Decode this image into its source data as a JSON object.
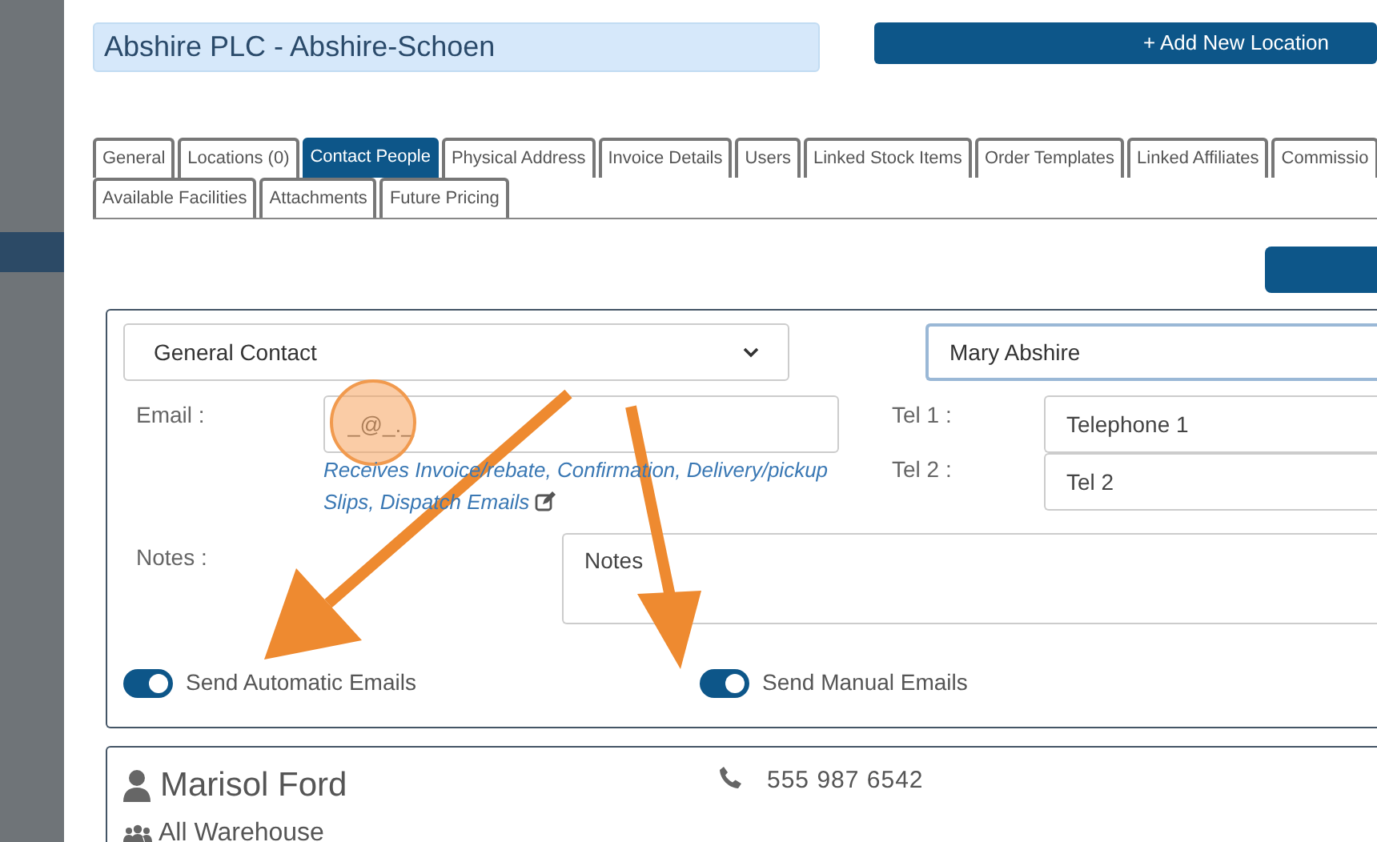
{
  "header": {
    "title": "Abshire PLC - Abshire-Schoen",
    "add_button": "+ Add New Location"
  },
  "tabs_row_1": [
    {
      "label": "General",
      "selected": false
    },
    {
      "label": "Locations (0)",
      "selected": false
    },
    {
      "label": "Contact People",
      "selected": true
    },
    {
      "label": "Physical Address",
      "selected": false
    },
    {
      "label": "Invoice Details",
      "selected": false
    },
    {
      "label": "Users",
      "selected": false
    },
    {
      "label": "Linked Stock Items",
      "selected": false
    },
    {
      "label": "Order Templates",
      "selected": false
    },
    {
      "label": "Linked Affiliates",
      "selected": false
    },
    {
      "label": "Commissio",
      "selected": false
    }
  ],
  "tabs_row_2": [
    {
      "label": "Available Facilities",
      "selected": false
    },
    {
      "label": "Attachments",
      "selected": false
    },
    {
      "label": "Future Pricing",
      "selected": false
    }
  ],
  "contact_form": {
    "contact_type": "General Contact",
    "name": "Mary Abshire",
    "email_label": "Email :",
    "email_placeholder": "_@_._",
    "email_note": "Receives Invoice/rebate, Confirmation, Delivery/pickup Slips, Dispatch Emails",
    "tel1_label": "Tel 1 :",
    "tel1_placeholder": "Telephone 1",
    "tel2_label": "Tel 2 :",
    "tel2_placeholder": "Tel 2",
    "notes_label": "Notes :",
    "notes_placeholder": "Notes",
    "toggles": [
      {
        "label": "Send Automatic Emails",
        "on": true
      },
      {
        "label": "Send Manual Emails",
        "on": true
      }
    ]
  },
  "contact_card": {
    "name": "Marisol Ford",
    "phone": "555 987 6542",
    "group": "All Warehouse"
  }
}
